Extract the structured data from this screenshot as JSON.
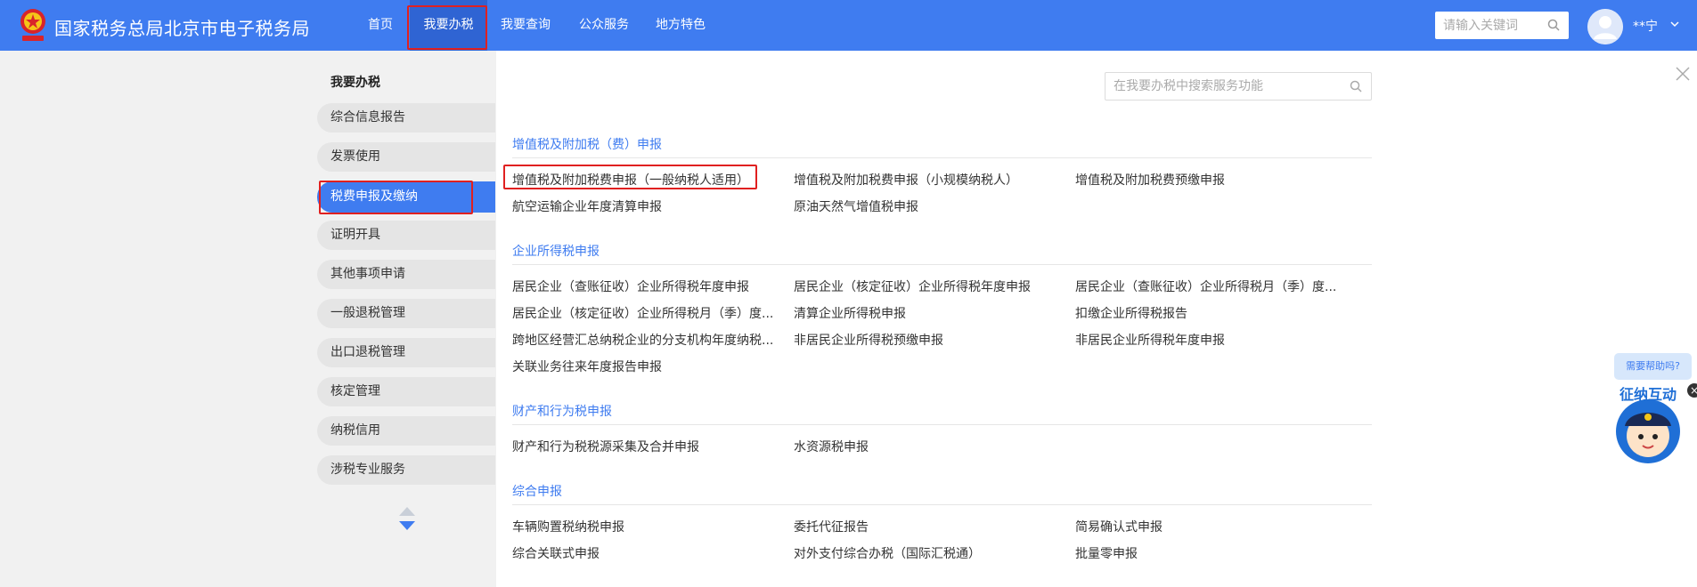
{
  "header": {
    "site_title": "国家税务总局北京市电子税务局",
    "nav": [
      "首页",
      "我要办税",
      "我要查询",
      "公众服务",
      "地方特色"
    ],
    "search_placeholder": "请输入关键词",
    "username": "**宁"
  },
  "sidebar": {
    "heading": "我要办税",
    "items": [
      "综合信息报告",
      "发票使用",
      "税费申报及缴纳",
      "证明开具",
      "其他事项申请",
      "一般退税管理",
      "出口退税管理",
      "核定管理",
      "纳税信用",
      "涉税专业服务"
    ]
  },
  "content": {
    "search_placeholder": "在我要办税中搜索服务功能",
    "sections": [
      {
        "title": "增值税及附加税（费）申报",
        "links": [
          "增值税及附加税费申报（一般纳税人适用）",
          "增值税及附加税费申报（小规模纳税人）",
          "增值税及附加税费预缴申报",
          "航空运输企业年度清算申报",
          "原油天然气增值税申报"
        ]
      },
      {
        "title": "企业所得税申报",
        "links": [
          "居民企业（查账征收）企业所得税年度申报",
          "居民企业（核定征收）企业所得税年度申报",
          "居民企业（查账征收）企业所得税月（季）度...",
          "居民企业（核定征收）企业所得税月（季）度...",
          "清算企业所得税申报",
          "扣缴企业所得税报告",
          "跨地区经营汇总纳税企业的分支机构年度纳税...",
          "非居民企业所得税预缴申报",
          "非居民企业所得税年度申报",
          "关联业务往来年度报告申报"
        ]
      },
      {
        "title": "财产和行为税申报",
        "links": [
          "财产和行为税税源采集及合并申报",
          "水资源税申报"
        ]
      },
      {
        "title": "综合申报",
        "links": [
          "车辆购置税纳税申报",
          "委托代征报告",
          "简易确认式申报",
          "综合关联式申报",
          "对外支付综合办税（国际汇税通）",
          "批量零申报"
        ]
      }
    ]
  },
  "help": {
    "bubble": "需要帮助吗?",
    "widget_label": "征纳互动"
  },
  "colors": {
    "header_blue": "#3f7cf0",
    "active_nav": "#2f64d3",
    "highlight_red": "#e02020",
    "sidebar_bg": "#f1f1f1"
  }
}
